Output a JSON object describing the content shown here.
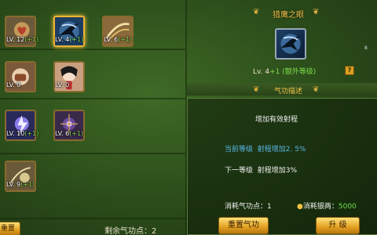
{
  "skills": [
    {
      "level": "LV. 12",
      "bonus": "(+1)"
    },
    {
      "level": "LV. 4",
      "bonus": "(+1)"
    },
    {
      "level": "LV. 6",
      "bonus": "(+1)"
    },
    {
      "level": "LV. 0",
      "bonus": ""
    },
    {
      "level": "LV. 0",
      "bonus": ""
    },
    {
      "level": "LV. 10",
      "bonus": "(+1)"
    },
    {
      "level": "LV. 6",
      "bonus": "(+1)"
    },
    {
      "level": "LV. 9",
      "bonus": "(+1)"
    }
  ],
  "left": {
    "remaining_label": "剩余气功点：",
    "remaining_value": "2",
    "reset_partial": "重置"
  },
  "detail": {
    "title": "猎鹰之眼",
    "level_text": "Lv. 4",
    "level_plus": "+1 (额外等级)",
    "help": "?",
    "small_mark": "8",
    "section_title": "气功描述",
    "effect": "增加有效射程",
    "current_label": "当前等级",
    "current_effect": "射程增加2. 5%",
    "next_label": "下一等级",
    "next_effect": "射程增加3%",
    "cost_points_label": "消耗气功点：",
    "cost_points_value": "1",
    "cost_silver_label": "消耗银两：",
    "cost_silver_value": "5000",
    "reset_button": "重置气功",
    "upgrade_button": "升  级"
  },
  "colors": {
    "accent_gold": "#f2c24a",
    "bonus_green": "#7fdc4a",
    "current_blue": "#5ab8e8",
    "silver_green": "#6ee04a"
  }
}
